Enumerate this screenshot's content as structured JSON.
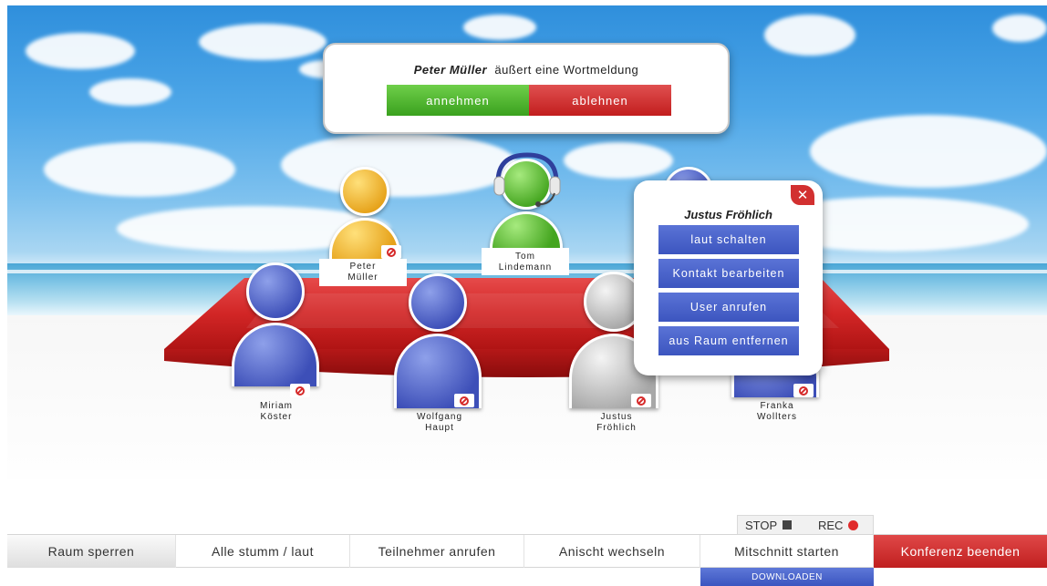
{
  "request": {
    "name": "Peter Müller",
    "text": "äußert eine Wortmeldung",
    "accept_label": "annehmen",
    "reject_label": "ablehnen"
  },
  "participants": [
    {
      "first": "Peter",
      "last": "Müller",
      "color": "#e6a21a",
      "muted": true
    },
    {
      "first": "Tom",
      "last": "Lindemann",
      "color": "#44a51f",
      "muted": false,
      "headset": true
    },
    {
      "first": "Miriam",
      "last": "Köster",
      "color": "#3d4fb8",
      "muted": true
    },
    {
      "first": "Wolfgang",
      "last": "Haupt",
      "color": "#3d4fb8",
      "muted": true
    },
    {
      "first": "Justus",
      "last": "Fröhlich",
      "color": "#a8a8a8",
      "muted": true
    },
    {
      "first": "Franka",
      "last": "Wollters",
      "color": "#3d4fb8",
      "muted": true
    }
  ],
  "context_menu": {
    "title": "Justus Fröhlich",
    "close_symbol": "✕",
    "items": [
      "laut schalten",
      "Kontakt bearbeiten",
      "User anrufen",
      "aus Raum entfernen"
    ]
  },
  "recording": {
    "stop_label": "STOP",
    "rec_label": "REC"
  },
  "toolbar": {
    "items": [
      "Raum sperren",
      "Alle stumm / laut",
      "Teilnehmer anrufen",
      "Anischt wechseln",
      "Mitschnitt starten",
      "Konferenz beenden"
    ],
    "download_label": "DOWNLOADEN"
  },
  "colors": {
    "accept": "#3aa11e",
    "reject": "#c21e1e",
    "menu_blue": "#3c55bf",
    "end_red": "#c01f1f"
  }
}
